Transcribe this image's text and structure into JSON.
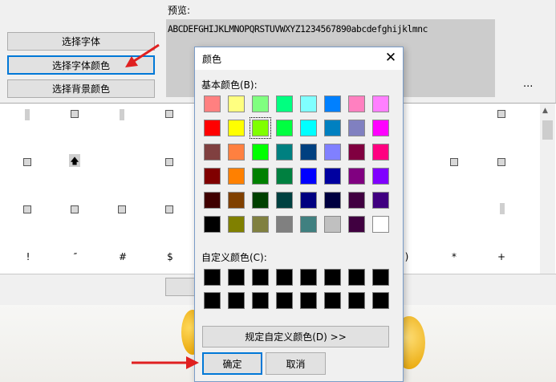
{
  "app": {
    "buttons": {
      "select_font": "选择字体",
      "select_font_color": "选择字体颜色",
      "select_bg_color": "选择背景颜色"
    },
    "preview_label": "预览:",
    "preview_text": "ABCDEFGHIJKLMNOPQRSTUVWXYZ1234567890abcdefghijklmnc",
    "preview_more": "...",
    "glyph_rows": [
      [
        "▮",
        "□",
        "▮",
        "□",
        "□"
      ],
      [
        "□",
        "🡅",
        "□",
        "□",
        "□"
      ],
      [
        "□",
        "□",
        "□",
        "□",
        "▮"
      ],
      [
        "!",
        "″",
        "#",
        "$",
        "*",
        "+"
      ]
    ],
    "visible_glyphs": {
      "paren_close": ")",
      "asterisk": "*",
      "plus": "+"
    }
  },
  "dialog": {
    "title": "颜色",
    "close_glyph": "✕",
    "basic_colors_label": "基本颜色(B):",
    "custom_colors_label": "自定义颜色(C):",
    "define_custom_label": "规定自定义颜色(D) >>",
    "ok_label": "确定",
    "cancel_label": "取消",
    "basic_colors": [
      [
        "#ff8080",
        "#ffff80",
        "#80ff80",
        "#00ff80",
        "#80ffff",
        "#0080ff",
        "#ff80c0",
        "#ff80ff"
      ],
      [
        "#ff0000",
        "#ffff00",
        "#80ff00",
        "#00ff40",
        "#00ffff",
        "#0080c0",
        "#8080c0",
        "#ff00ff"
      ],
      [
        "#804040",
        "#ff8040",
        "#00ff00",
        "#008080",
        "#004080",
        "#8080ff",
        "#800040",
        "#ff0080"
      ],
      [
        "#800000",
        "#ff8000",
        "#008000",
        "#008040",
        "#0000ff",
        "#0000a0",
        "#800080",
        "#8000ff"
      ],
      [
        "#400000",
        "#804000",
        "#004000",
        "#004040",
        "#000080",
        "#000040",
        "#400040",
        "#400080"
      ],
      [
        "#000000",
        "#808000",
        "#808040",
        "#808080",
        "#408080",
        "#c0c0c0",
        "#400040",
        "#ffffff"
      ]
    ],
    "selected_color": "#80ff00",
    "custom_colors": [
      [
        "#000000",
        "#000000",
        "#000000",
        "#000000",
        "#000000",
        "#000000",
        "#000000",
        "#000000"
      ],
      [
        "#000000",
        "#000000",
        "#000000",
        "#000000",
        "#000000",
        "#000000",
        "#000000",
        "#000000"
      ]
    ]
  },
  "colors": {
    "accent": "#0078d7",
    "annotation_arrow": "#e02020"
  }
}
